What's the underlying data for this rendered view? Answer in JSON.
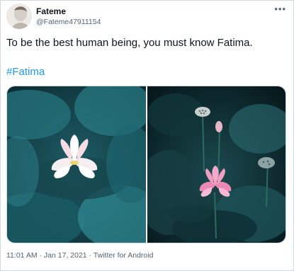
{
  "user": {
    "display_name": "Fateme",
    "handle": "@Fateme47911154"
  },
  "tweet": {
    "text": "To be the best human being, you must know Fatima.",
    "hashtag": "#Fatima",
    "timestamp": "11:01 AM · Jan 17, 2021",
    "separator": " · ",
    "source": "Twitter for Android"
  },
  "icons": {
    "more": "more-dots-icon"
  },
  "colors": {
    "link": "#1d9bf0",
    "secondary_text": "#536471",
    "border": "#cfd9de"
  }
}
